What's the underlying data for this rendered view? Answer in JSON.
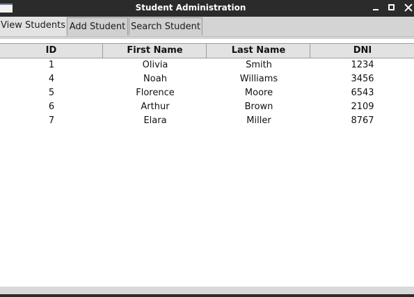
{
  "window": {
    "title": "Student Administration"
  },
  "tabs": [
    {
      "label": "View Students",
      "active": true
    },
    {
      "label": "Add Student",
      "active": false
    },
    {
      "label": "Search Student",
      "active": false
    }
  ],
  "table": {
    "columns": [
      "ID",
      "First Name",
      "Last Name",
      "DNI"
    ],
    "rows": [
      [
        "1",
        "Olivia",
        "Smith",
        "1234"
      ],
      [
        "4",
        "Noah",
        "Williams",
        "3456"
      ],
      [
        "5",
        "Florence",
        "Moore",
        "6543"
      ],
      [
        "6",
        "Arthur",
        "Brown",
        "2109"
      ],
      [
        "7",
        "Elara",
        "Miller",
        "8767"
      ]
    ]
  },
  "colors": {
    "titlebar": "#2b2b2b",
    "tabbar": "#d4d4d4",
    "header": "#e2e2e2",
    "background": "#ffffff"
  },
  "icons": [
    "app-icon",
    "minimize-icon",
    "maximize-icon",
    "close-icon"
  ]
}
